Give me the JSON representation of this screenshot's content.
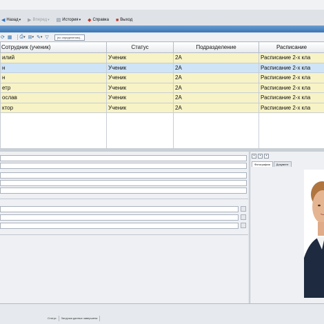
{
  "menu": {
    "back": "Назад",
    "forward": "Вперед",
    "history": "История",
    "help": "Справка",
    "exit": "Выход"
  },
  "toolbar": {
    "field_text": "(по определению)..."
  },
  "table": {
    "headers": [
      "Сотрудник (ученик)",
      "Статус",
      "Подразделение",
      "Расписание"
    ],
    "rows": [
      [
        "илий",
        "Ученик",
        "2А",
        "Расписание 2-х кла"
      ],
      [
        "н",
        "Ученик",
        "2А",
        "Расписание 2-х кла"
      ],
      [
        "н",
        "Ученик",
        "2А",
        "Расписание 2-х кла"
      ],
      [
        "етр",
        "Ученик",
        "2А",
        "Расписание 2-х кла"
      ],
      [
        "ослав",
        "Ученик",
        "2А",
        "Расписание 2-х кла"
      ],
      [
        "ктор",
        "Ученик",
        "2А",
        "Расписание 2-х кла"
      ]
    ],
    "selected_row": 1
  },
  "photo_panel": {
    "tabs": [
      "Фотография",
      "Документ"
    ]
  },
  "status": {
    "label": "Статус",
    "message": "Загрузка данных завершена"
  },
  "colors": {
    "row_highlight": "#f7f3c6",
    "row_selected": "#cfe4f7",
    "title_bar": "#3a75b5"
  }
}
